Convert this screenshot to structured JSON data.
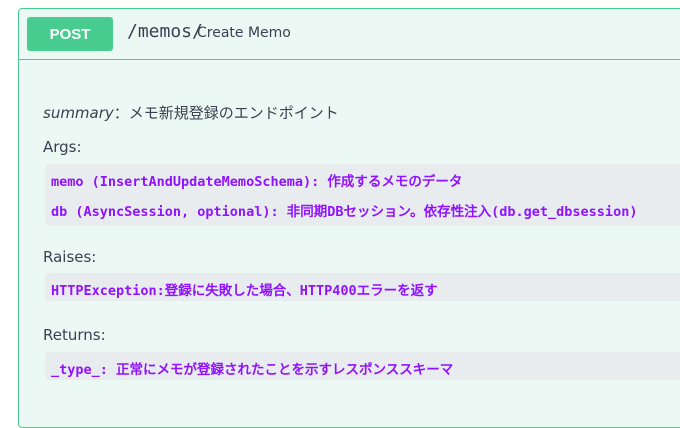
{
  "operation": {
    "method": "POST",
    "path": "/memos/",
    "description": "Create Memo"
  },
  "docstring": {
    "summary_label": "summary",
    "summary_text": "：メモ新規登録のエンドポイント",
    "args_heading": "Args:",
    "args": [
      "memo (InsertAndUpdateMemoSchema): 作成するメモのデータ",
      "db (AsyncSession, optional): 非同期DBセッション。依存性注入(db.get_dbsession)"
    ],
    "raises_heading": "Raises:",
    "raises": [
      "HTTPException:登録に失敗した場合、HTTP400エラーを返す"
    ],
    "returns_heading": "Returns:",
    "returns": [
      "_type_: 正常にメモが登録されたことを示すレスポンススキーマ"
    ]
  },
  "colors": {
    "accent": "#49cc90",
    "background": "#ecf8f3",
    "code_text": "#9012fe",
    "code_background": "#e8ecef"
  }
}
